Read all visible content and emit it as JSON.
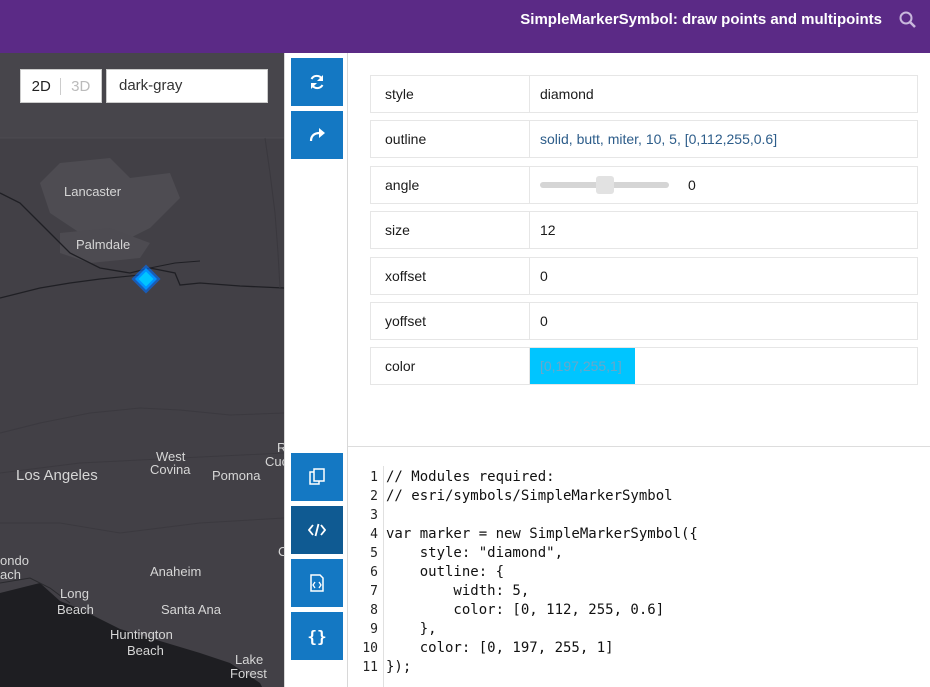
{
  "header": {
    "title": "SimpleMarkerSymbol: draw points and multipoints",
    "search_icon": "search-icon"
  },
  "map": {
    "view_toggle": {
      "two_d": "2D",
      "three_d": "3D",
      "selected": "2D"
    },
    "basemap": "dark-gray",
    "labels": {
      "lancaster": "Lancaster",
      "palmdale": "Palmdale",
      "los_angeles": "Los Angeles",
      "west": "West",
      "covina": "Covina",
      "pomona": "Pomona",
      "r": "R",
      "cuc": "Cuc",
      "ondo": "ondo",
      "ach": "ach",
      "anaheim": "Anaheim",
      "long": "Long",
      "beach": "Beach",
      "santa_ana": "Santa Ana",
      "huntington": "Huntington",
      "beach2": "Beach",
      "lake": "Lake",
      "forest": "Forest",
      "c": "C"
    },
    "marker_color": "#00c5ff",
    "outline_color": "#0070ff"
  },
  "sidebar": {
    "buttons": [
      "refresh-icon",
      "share-icon",
      "copy-icon",
      "code-icon",
      "code-file-icon",
      "json-icon"
    ],
    "json_label": "{}"
  },
  "properties": [
    {
      "key": "style",
      "value": "diamond"
    },
    {
      "key": "outline",
      "value": "solid, butt, miter, 10, 5, [0,112,255,0.6]"
    },
    {
      "key": "angle",
      "value": "0"
    },
    {
      "key": "size",
      "value": "12"
    },
    {
      "key": "xoffset",
      "value": "0"
    },
    {
      "key": "yoffset",
      "value": "0"
    },
    {
      "key": "color",
      "value": "[0,197,255,1]"
    }
  ],
  "angle_slider_level": 0.5,
  "code_lines": [
    "// Modules required:",
    "// esri/symbols/SimpleMarkerSymbol",
    "",
    "var marker = new SimpleMarkerSymbol({",
    "    style: \"diamond\",",
    "    outline: {",
    "        width: 5,",
    "        color: [0, 112, 255, 0.6]",
    "    },",
    "    color: [0, 197, 255, 1]",
    "});"
  ],
  "accent_colors": {
    "header": "#5b2a86",
    "button": "#1478c3",
    "swatch": "#00c5ff"
  }
}
